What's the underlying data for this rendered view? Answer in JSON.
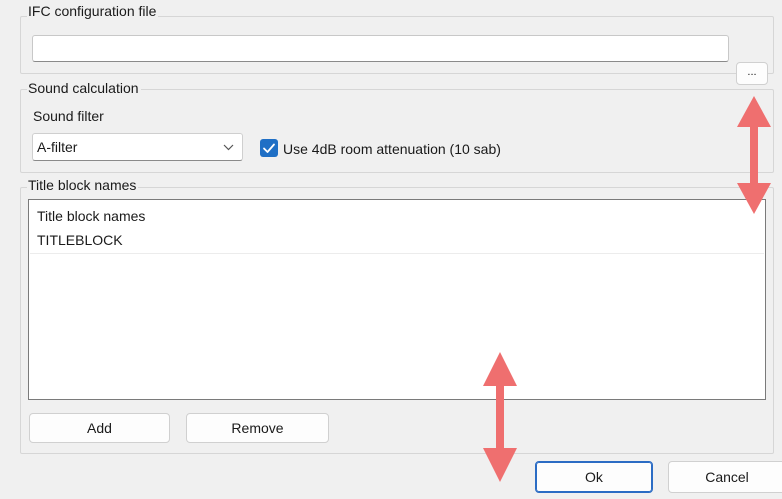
{
  "ifc": {
    "group_label": "IFC configuration file",
    "path_value": "",
    "browse_label": "..."
  },
  "sound": {
    "group_label": "Sound calculation",
    "filter_label": "Sound filter",
    "filter_selected": "A-filter",
    "attenuation_label": "Use 4dB room attenuation (10 sab)",
    "attenuation_checked": true
  },
  "titleblock": {
    "group_label": "Title block names",
    "list_header": "Title block names",
    "items": [
      "TITLEBLOCK"
    ],
    "add_label": "Add",
    "remove_label": "Remove"
  },
  "dialog": {
    "ok_label": "Ok",
    "cancel_label": "Cancel"
  },
  "annotation": {
    "arrow_color": "#ef6f6f"
  },
  "icons": {
    "combo_arrow": "chevron-down-icon",
    "checkbox": "checkmark-icon",
    "resize_arrows": "double-arrow-vertical-icon"
  }
}
